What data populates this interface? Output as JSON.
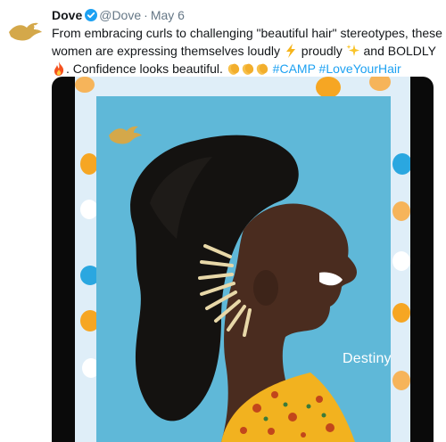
{
  "tweet": {
    "author_name": "Dove",
    "handle": "@Dove",
    "separator": "·",
    "date": "May 6",
    "text_part1": "From embracing curls to challenging \"beautiful hair\" stereotypes, these women are expressing themselves loudly",
    "text_part2": "proudly",
    "text_part3": "and BOLDLY",
    "text_part4": ". Confidence looks beautiful.",
    "hashtag1": "#CAMP",
    "hashtag2": "#LoveYourHair"
  },
  "media": {
    "caption": "Destiny D"
  },
  "icons": {
    "avatar": "dove-logo-icon",
    "verified": "verified-badge-icon",
    "emoji1": "lightning-emoji-icon",
    "emoji2": "sparkles-emoji-icon",
    "emoji3": "fire-emoji-icon",
    "emoji4": "clapping-hands-emoji-icon"
  },
  "colors": {
    "brand_gold": "#d4a84a",
    "link_blue": "#1da1f2",
    "photo_background": "#5fb8d8",
    "confetti_orange": "#f6a623",
    "confetti_blue": "#2aa7e0"
  }
}
